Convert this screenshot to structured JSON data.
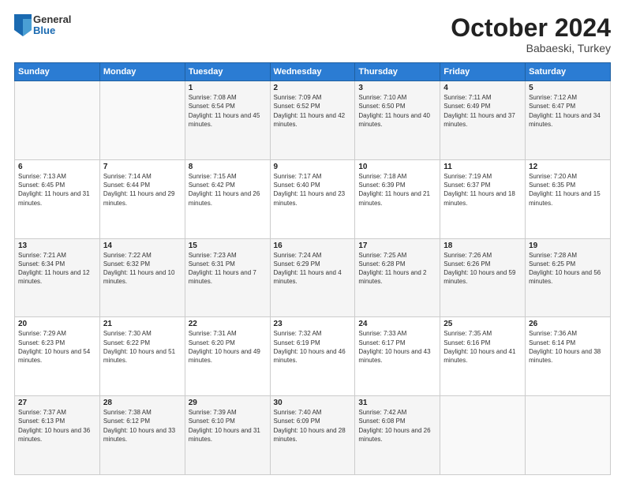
{
  "header": {
    "logo": {
      "general": "General",
      "blue": "Blue"
    },
    "title": "October 2024",
    "location": "Babaeski, Turkey"
  },
  "weekdays": [
    "Sunday",
    "Monday",
    "Tuesday",
    "Wednesday",
    "Thursday",
    "Friday",
    "Saturday"
  ],
  "weeks": [
    [
      {
        "day": null,
        "info": ""
      },
      {
        "day": null,
        "info": ""
      },
      {
        "day": "1",
        "info": "Sunrise: 7:08 AM\nSunset: 6:54 PM\nDaylight: 11 hours and 45 minutes."
      },
      {
        "day": "2",
        "info": "Sunrise: 7:09 AM\nSunset: 6:52 PM\nDaylight: 11 hours and 42 minutes."
      },
      {
        "day": "3",
        "info": "Sunrise: 7:10 AM\nSunset: 6:50 PM\nDaylight: 11 hours and 40 minutes."
      },
      {
        "day": "4",
        "info": "Sunrise: 7:11 AM\nSunset: 6:49 PM\nDaylight: 11 hours and 37 minutes."
      },
      {
        "day": "5",
        "info": "Sunrise: 7:12 AM\nSunset: 6:47 PM\nDaylight: 11 hours and 34 minutes."
      }
    ],
    [
      {
        "day": "6",
        "info": "Sunrise: 7:13 AM\nSunset: 6:45 PM\nDaylight: 11 hours and 31 minutes."
      },
      {
        "day": "7",
        "info": "Sunrise: 7:14 AM\nSunset: 6:44 PM\nDaylight: 11 hours and 29 minutes."
      },
      {
        "day": "8",
        "info": "Sunrise: 7:15 AM\nSunset: 6:42 PM\nDaylight: 11 hours and 26 minutes."
      },
      {
        "day": "9",
        "info": "Sunrise: 7:17 AM\nSunset: 6:40 PM\nDaylight: 11 hours and 23 minutes."
      },
      {
        "day": "10",
        "info": "Sunrise: 7:18 AM\nSunset: 6:39 PM\nDaylight: 11 hours and 21 minutes."
      },
      {
        "day": "11",
        "info": "Sunrise: 7:19 AM\nSunset: 6:37 PM\nDaylight: 11 hours and 18 minutes."
      },
      {
        "day": "12",
        "info": "Sunrise: 7:20 AM\nSunset: 6:35 PM\nDaylight: 11 hours and 15 minutes."
      }
    ],
    [
      {
        "day": "13",
        "info": "Sunrise: 7:21 AM\nSunset: 6:34 PM\nDaylight: 11 hours and 12 minutes."
      },
      {
        "day": "14",
        "info": "Sunrise: 7:22 AM\nSunset: 6:32 PM\nDaylight: 11 hours and 10 minutes."
      },
      {
        "day": "15",
        "info": "Sunrise: 7:23 AM\nSunset: 6:31 PM\nDaylight: 11 hours and 7 minutes."
      },
      {
        "day": "16",
        "info": "Sunrise: 7:24 AM\nSunset: 6:29 PM\nDaylight: 11 hours and 4 minutes."
      },
      {
        "day": "17",
        "info": "Sunrise: 7:25 AM\nSunset: 6:28 PM\nDaylight: 11 hours and 2 minutes."
      },
      {
        "day": "18",
        "info": "Sunrise: 7:26 AM\nSunset: 6:26 PM\nDaylight: 10 hours and 59 minutes."
      },
      {
        "day": "19",
        "info": "Sunrise: 7:28 AM\nSunset: 6:25 PM\nDaylight: 10 hours and 56 minutes."
      }
    ],
    [
      {
        "day": "20",
        "info": "Sunrise: 7:29 AM\nSunset: 6:23 PM\nDaylight: 10 hours and 54 minutes."
      },
      {
        "day": "21",
        "info": "Sunrise: 7:30 AM\nSunset: 6:22 PM\nDaylight: 10 hours and 51 minutes."
      },
      {
        "day": "22",
        "info": "Sunrise: 7:31 AM\nSunset: 6:20 PM\nDaylight: 10 hours and 49 minutes."
      },
      {
        "day": "23",
        "info": "Sunrise: 7:32 AM\nSunset: 6:19 PM\nDaylight: 10 hours and 46 minutes."
      },
      {
        "day": "24",
        "info": "Sunrise: 7:33 AM\nSunset: 6:17 PM\nDaylight: 10 hours and 43 minutes."
      },
      {
        "day": "25",
        "info": "Sunrise: 7:35 AM\nSunset: 6:16 PM\nDaylight: 10 hours and 41 minutes."
      },
      {
        "day": "26",
        "info": "Sunrise: 7:36 AM\nSunset: 6:14 PM\nDaylight: 10 hours and 38 minutes."
      }
    ],
    [
      {
        "day": "27",
        "info": "Sunrise: 7:37 AM\nSunset: 6:13 PM\nDaylight: 10 hours and 36 minutes."
      },
      {
        "day": "28",
        "info": "Sunrise: 7:38 AM\nSunset: 6:12 PM\nDaylight: 10 hours and 33 minutes."
      },
      {
        "day": "29",
        "info": "Sunrise: 7:39 AM\nSunset: 6:10 PM\nDaylight: 10 hours and 31 minutes."
      },
      {
        "day": "30",
        "info": "Sunrise: 7:40 AM\nSunset: 6:09 PM\nDaylight: 10 hours and 28 minutes."
      },
      {
        "day": "31",
        "info": "Sunrise: 7:42 AM\nSunset: 6:08 PM\nDaylight: 10 hours and 26 minutes."
      },
      {
        "day": null,
        "info": ""
      },
      {
        "day": null,
        "info": ""
      }
    ]
  ]
}
